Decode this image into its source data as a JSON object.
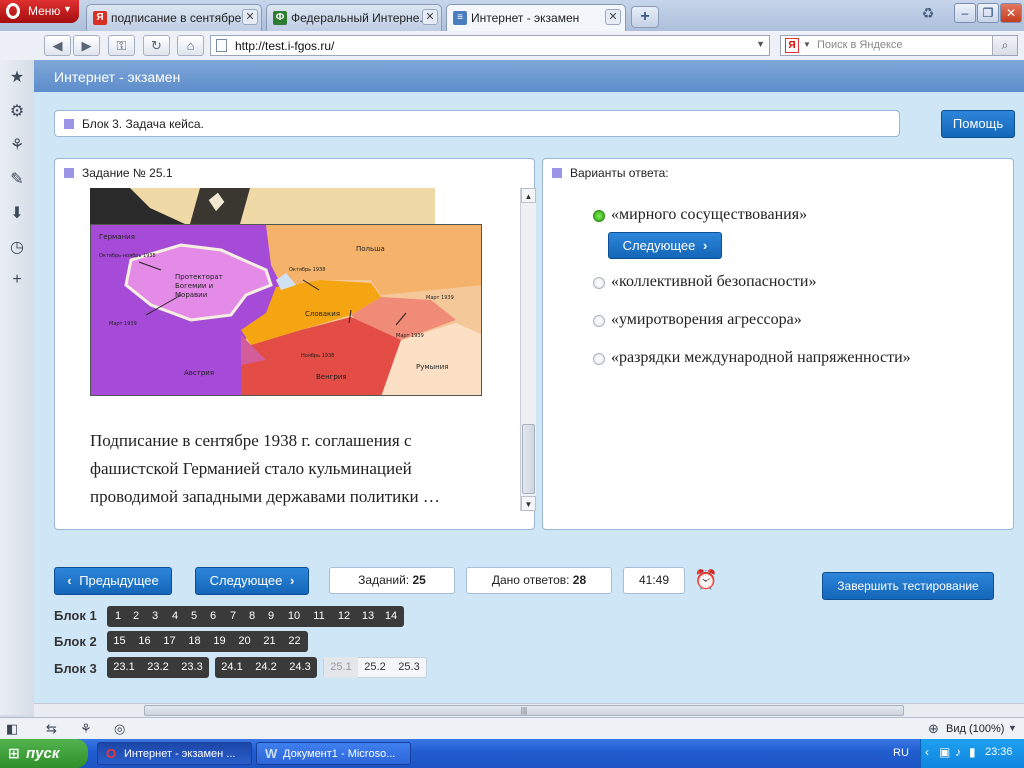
{
  "browser": {
    "menu_label": "Меню",
    "tabs": [
      {
        "title": "подписание в сентябре ...",
        "favicon": "Я",
        "favicon_color": "#d93025",
        "active": false
      },
      {
        "title": "Федеральный Интерне...",
        "favicon": "Ф",
        "favicon_color": "#2e7d32",
        "active": false
      },
      {
        "title": "Интернет - экзамен",
        "favicon": "≡",
        "favicon_color": "#4a7cc0",
        "active": true
      }
    ],
    "url": "http://test.i-fgos.ru/",
    "search_placeholder": "Поиск в Яндексе",
    "search_engine_label": "Я",
    "zoom_label": "Вид (100%)"
  },
  "app": {
    "title": "Интернет - экзамен",
    "block_title": "Блок 3. Задача кейса.",
    "help_label": "Помощь",
    "task_title": "Задание № 25.1",
    "answers_title": "Варианты ответа:",
    "question": "Подписание в сентябре 1938 г. соглашения с фашистской Германией стало кульминацией проводимой западными державами политики …",
    "options": [
      {
        "text": "«мирного сосуществования»",
        "selected": true
      },
      {
        "text": "«коллективной безопасности»",
        "selected": false
      },
      {
        "text": "«умиротворения агрессора»",
        "selected": false
      },
      {
        "text": "«разрядки международной напряженности»",
        "selected": false
      }
    ],
    "next_inline_label": "Следующее",
    "prev_label": "Предыдущее",
    "next_label": "Следующее",
    "tasks_label": "Заданий:",
    "tasks_count": "25",
    "answered_label": "Дано ответов:",
    "answered_count": "28",
    "timer": "41:49",
    "finish_label": "Завершить тестирование",
    "accent_color": "#1a70c5"
  },
  "map": {
    "labels": [
      "Германия",
      "Польша",
      "Протекторат Богемии и Моравии",
      "Словакия",
      "Австрия",
      "Венгрия",
      "Румыния",
      "Октябрь 1938",
      "Март 1939",
      "Ноябрь 1938",
      "Март 1939",
      "Октябрь-ноябрь 1938",
      "Март 1939"
    ]
  },
  "blocks": [
    {
      "label": "Блок 1",
      "groups": [
        {
          "items": [
            "1",
            "2",
            "3",
            "4",
            "5",
            "6",
            "7",
            "8",
            "9",
            "10",
            "11",
            "12",
            "13",
            "14"
          ],
          "style": "dark"
        }
      ]
    },
    {
      "label": "Блок 2",
      "groups": [
        {
          "items": [
            "15",
            "16",
            "17",
            "18",
            "19",
            "20",
            "21",
            "22"
          ],
          "style": "dark"
        }
      ]
    },
    {
      "label": "Блок 3",
      "groups": [
        {
          "items": [
            "23.1",
            "23.2",
            "23.3"
          ],
          "style": "dark"
        },
        {
          "items": [
            "24.1",
            "24.2",
            "24.3"
          ],
          "style": "dark"
        },
        {
          "items": [
            "25.1",
            "25.2",
            "25.3"
          ],
          "style": "light"
        }
      ]
    }
  ],
  "taskbar": {
    "start_label": "пуск",
    "tasks": [
      {
        "label": "Интернет - экзамен ...",
        "active": true
      },
      {
        "label": "Документ1 - Microso...",
        "active": false
      }
    ],
    "lang": "RU",
    "clock": "23:36"
  }
}
